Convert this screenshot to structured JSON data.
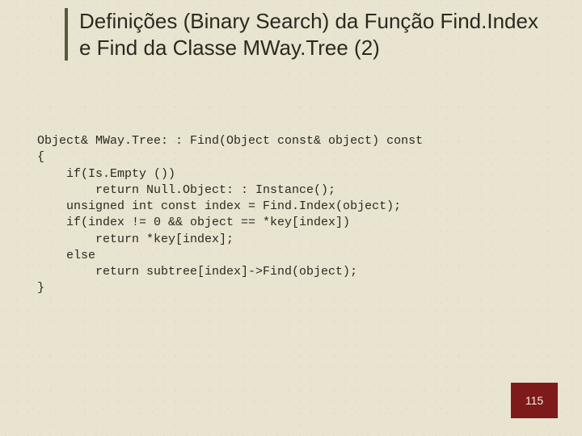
{
  "slide": {
    "title": "Definições (Binary Search) da Função Find.Index e Find da Classe MWay.Tree (2)"
  },
  "code": {
    "lines": [
      "Object& MWay.Tree: : Find(Object const& object) const",
      "{",
      "    if(Is.Empty ())",
      "        return Null.Object: : Instance();",
      "    unsigned int const index = Find.Index(object);",
      "    if(index != 0 && object == *key[index])",
      "        return *key[index];",
      "    else",
      "        return subtree[index]->Find(object);",
      "}"
    ]
  },
  "footer": {
    "page_number": "115"
  },
  "colors": {
    "background": "#e8e4d0",
    "title_bar": "#5a5a3a",
    "footer_bg": "#7e1a1a",
    "text": "#2a2a20"
  }
}
